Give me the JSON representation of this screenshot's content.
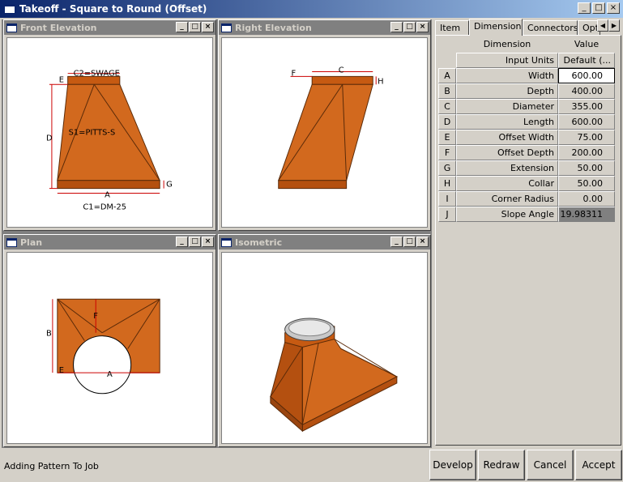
{
  "window": {
    "title": "Takeoff - Square to Round (Offset)",
    "minimize_glyph": "_",
    "maximize_glyph": "□",
    "close_glyph": "×"
  },
  "views": [
    {
      "title": "Front Elevation"
    },
    {
      "title": "Right Elevation"
    },
    {
      "title": "Plan"
    },
    {
      "title": "Isometric"
    }
  ],
  "view_buttons": {
    "min": "_",
    "max": "□",
    "close": "×"
  },
  "front_labels": {
    "c2": "C2=SWAGE",
    "s1": "S1=PITTS-S",
    "c1": "C1=DM-25",
    "a": "A",
    "d": "D",
    "e": "E",
    "g": "G"
  },
  "right_labels": {
    "c": "C",
    "f": "F",
    "h": "H"
  },
  "plan_labels": {
    "b": "B",
    "f": "F",
    "a": "A",
    "e": "E"
  },
  "tabs": [
    "Item",
    "Dimensions",
    "Connectors",
    "Opt"
  ],
  "active_tab": "Dimensions",
  "tab_scroll": {
    "left": "◀",
    "right": "▶"
  },
  "grid": {
    "header": {
      "name": "Dimension",
      "value": "Value"
    },
    "units_row": {
      "name": "Input Units",
      "value": "Default (..."
    },
    "rows": [
      {
        "key": "A",
        "name": "Width",
        "value": "600.00"
      },
      {
        "key": "B",
        "name": "Depth",
        "value": "400.00"
      },
      {
        "key": "C",
        "name": "Diameter",
        "value": "355.00"
      },
      {
        "key": "D",
        "name": "Length",
        "value": "600.00"
      },
      {
        "key": "E",
        "name": "Offset Width",
        "value": "75.00"
      },
      {
        "key": "F",
        "name": "Offset Depth",
        "value": "200.00"
      },
      {
        "key": "G",
        "name": "Extension",
        "value": "50.00"
      },
      {
        "key": "H",
        "name": "Collar",
        "value": "50.00"
      },
      {
        "key": "I",
        "name": "Corner Radius",
        "value": "0.00"
      },
      {
        "key": "J",
        "name": "Slope Angle",
        "value": "19.98311"
      }
    ]
  },
  "status": "Adding Pattern To Job",
  "actions": {
    "develop": "Develop",
    "redraw": "Redraw",
    "cancel": "Cancel",
    "accept": "Accept"
  },
  "colors": {
    "duct": "#d2691e",
    "duct_dark": "#8b3a0a",
    "dim_line": "#cc0000",
    "titlebar": "#0a246a"
  }
}
